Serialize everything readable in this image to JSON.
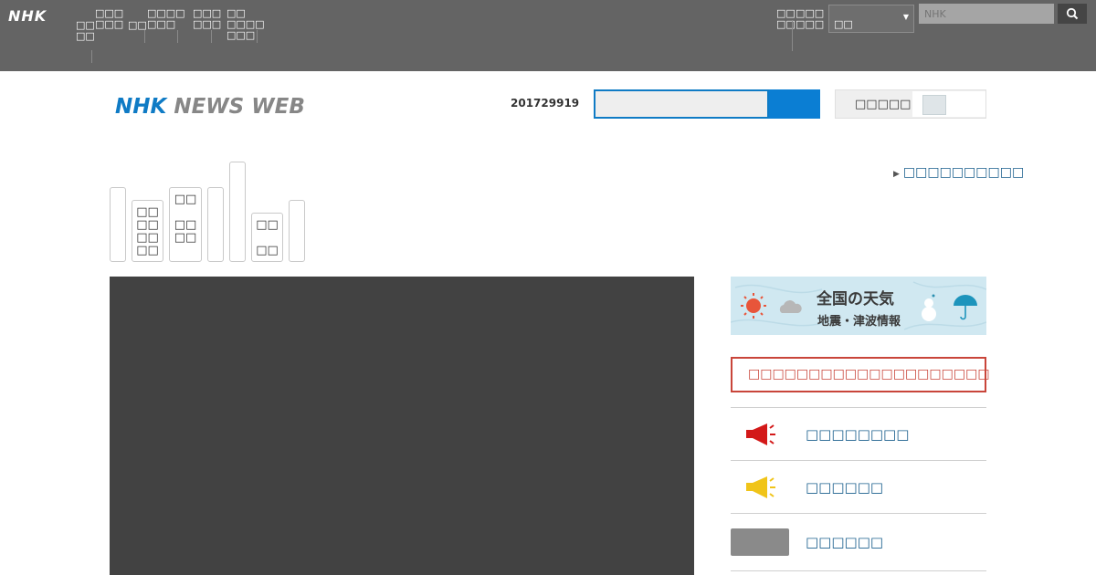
{
  "global_header": {
    "logo": "NHK",
    "nav": [
      {
        "label": "□□\n□□"
      },
      {
        "label": "□□□\n□□□"
      },
      {
        "label": "□□"
      },
      {
        "label": "□□□□\n□□□"
      },
      {
        "label": "□□□\n□□□"
      },
      {
        "label": "□□\n□□□□\n□□□"
      }
    ],
    "right_nav": [
      {
        "label": "□□\n□□"
      },
      {
        "label": "□□□\n□□□"
      }
    ],
    "select_value": "□□",
    "search_placeholder": "NHK"
  },
  "news_header": {
    "logo_nhk": "NHK",
    "logo_news_web": "NEWS WEB",
    "date": "201729919",
    "toggle_label": "□□□□□"
  },
  "tabs": [
    {
      "label": ""
    },
    {
      "label": "□□\n□□\n□□\n□□"
    },
    {
      "label": "□□\n\n□□\n□□"
    },
    {
      "label": ""
    },
    {
      "label": ""
    },
    {
      "label": "□□\n\n□□"
    },
    {
      "label": ""
    }
  ],
  "tab_link": "□□□□□□□□□□",
  "sidebar": {
    "weather_title": "全国の天気",
    "weather_sub": "地震・津波情報",
    "alert": "□□□□□□□□□□□□□□□□□□□□",
    "rows": [
      {
        "label": "□□□□□□□□"
      },
      {
        "label": "□□□□□□"
      },
      {
        "label": "□□□□□□"
      }
    ]
  },
  "colors": {
    "global_header_bg": "#646464",
    "brand_blue": "#0f7bc5",
    "link_blue": "#1a5f8d",
    "alert_red": "#c9453a",
    "player_bg": "#424242"
  }
}
